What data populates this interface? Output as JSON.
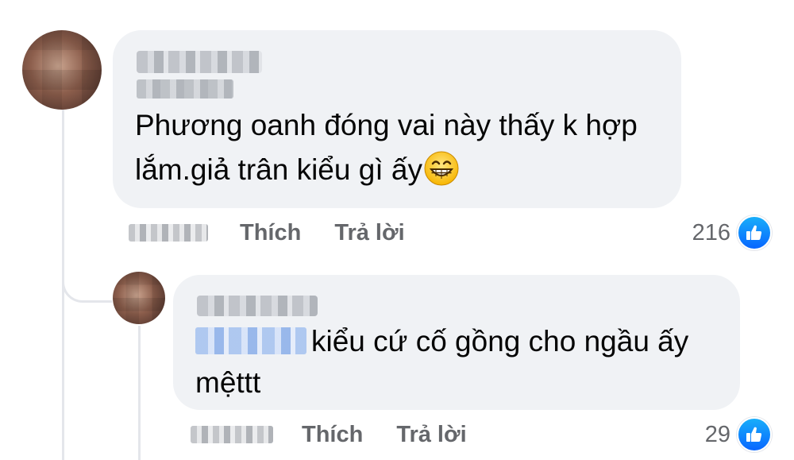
{
  "comment": {
    "author_name": "",
    "text_line1": "Phương oanh đóng vai này thấy k hợp",
    "text_line2": "lắm.giả trân kiểu gì ấy",
    "emoji_icon": "grinning-face-icon",
    "like_label": "Thích",
    "reply_label": "Trả lời",
    "reaction_count": "216",
    "reaction_icon": "like-icon"
  },
  "reply": {
    "author_name": "",
    "text_line1": "kiểu cứ cố gồng cho ngầu ấy",
    "text_line2": "mệttt",
    "like_label": "Thích",
    "reply_label": "Trả lời",
    "reaction_count": "29",
    "reaction_icon": "like-icon"
  },
  "colors": {
    "bubble_bg": "#f0f2f5",
    "action_text": "#65676b",
    "like_blue": "#0866ff",
    "tag_blur": "#a8c4f0"
  }
}
